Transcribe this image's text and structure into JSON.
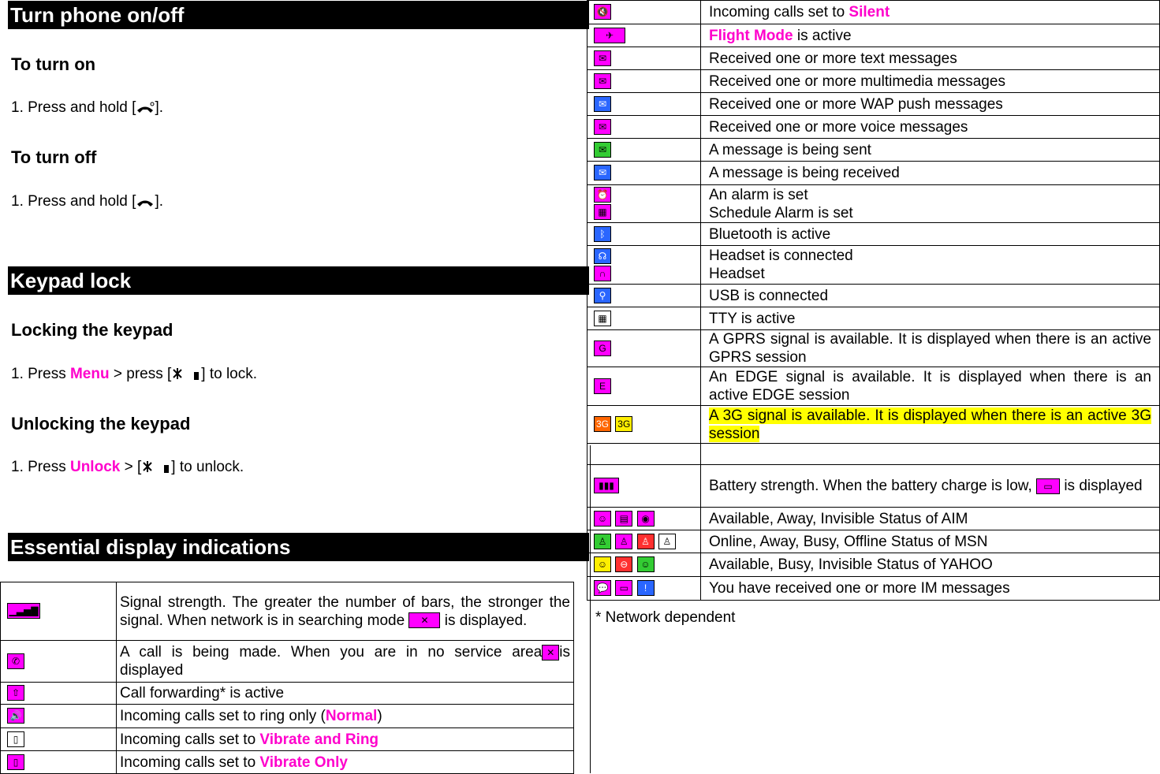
{
  "sections": {
    "power": {
      "title": "Turn phone on/off",
      "on_heading": "To turn on",
      "on_step_pre": "1.  Press and hold [",
      "on_step_post": "].",
      "off_heading": "To turn off",
      "off_step_pre": "1.  Press and hold [",
      "off_step_post": "]."
    },
    "keypad": {
      "title": "Keypad lock",
      "lock_heading": "Locking the keypad",
      "lock_step_pre": "1.    Press ",
      "lock_step_key": "Menu",
      "lock_step_post": " > press [",
      "lock_step_end": "] to lock.",
      "unlock_heading": "Unlocking the keypad",
      "unlock_step_pre": "1.    Press ",
      "unlock_step_key": "Unlock",
      "unlock_step_post": " > [",
      "unlock_step_end": "] to unlock."
    },
    "display": {
      "title": "Essential display indications"
    }
  },
  "left_rows": [
    {
      "icons": [
        "signal-icon"
      ],
      "text": "Signal strength. The greater the number of bars, the stronger the signal. When network is in searching mode",
      "tail": "is displayed."
    },
    {
      "icons": [
        "call-icon"
      ],
      "text": "A call is being made. When you are in no service area",
      "tail": "is displayed"
    },
    {
      "icons": [
        "call-forward-icon"
      ],
      "text": "Call forwarding* is active"
    },
    {
      "icons": [
        "ring-icon"
      ],
      "text_pre": "Incoming calls set to ring only (",
      "key": "Normal",
      "text_post": ")"
    },
    {
      "icons": [
        "vibrate-ring-icon"
      ],
      "text_pre": "Incoming calls set to ",
      "key": "Vibrate and Ring"
    },
    {
      "icons": [
        "vibrate-only-icon"
      ],
      "text_pre": "Incoming calls set to ",
      "key": "Vibrate Only"
    }
  ],
  "right_rows": [
    {
      "text_pre": "Incoming calls set to ",
      "key": "Silent"
    },
    {
      "key": "Flight Mode",
      "text_post": " is active"
    },
    {
      "text": "Received one or more text messages"
    },
    {
      "text": "Received one or more multimedia messages"
    },
    {
      "text": "Received one or more WAP push messages"
    },
    {
      "text": "Received one or more voice messages"
    },
    {
      "text": "A message is being sent"
    },
    {
      "text": "A message is being received"
    },
    {
      "line1": "An alarm is set",
      "line2": "Schedule Alarm is set"
    },
    {
      "text": "Bluetooth is active"
    },
    {
      "line1": "Headset is connected",
      "line2": "Headset"
    },
    {
      "text": "USB is connected"
    },
    {
      "text": "TTY is active"
    },
    {
      "text": "A GPRS signal is available. It is displayed when there is an active GPRS session"
    },
    {
      "text": "An EDGE signal is available. It is displayed when there is an active EDGE session"
    },
    {
      "text": "A 3G signal is available. It is displayed when there is an active 3G session"
    },
    {
      "text": ""
    },
    {
      "text": "Battery strength. When the battery charge is low,",
      "tail": "is displayed"
    },
    {
      "text": "Available, Away, Invisible Status of AIM"
    },
    {
      "text": "Online, Away, Busy, Offline Status of MSN"
    },
    {
      "text": "Available, Busy, Invisible Status of YAHOO"
    },
    {
      "text": "You have received one or more IM messages"
    }
  ],
  "footnote": "* Network dependent",
  "colors": {
    "highlight": "#ff00cc",
    "icon_bg": "#ff00ff",
    "yellow": "#ffff00"
  }
}
